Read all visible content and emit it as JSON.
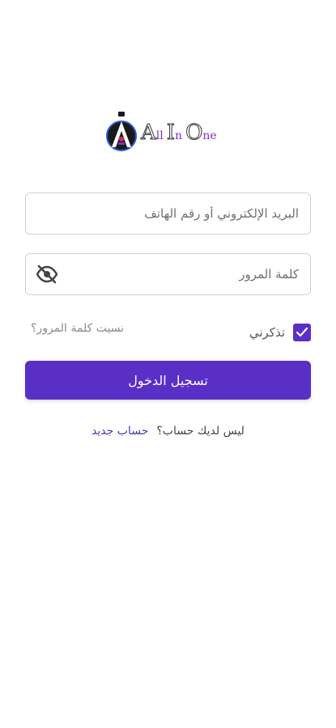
{
  "logo": {
    "letters_big": [
      "A",
      "I",
      "O"
    ],
    "letters_small": [
      "ll",
      "n",
      "ne"
    ],
    "accent_color": "#7b2fd6"
  },
  "login_form": {
    "email_placeholder": "البريد الإلكتروني أو رقم الهاتف",
    "email_value": "",
    "password_placeholder": "كلمة المرور",
    "password_value": "",
    "password_toggle_icon": "eye-off-icon",
    "remember_label": "تذكرني",
    "remember_checked": true,
    "forgot_password": "نسيت كلمة المرور؟",
    "login_label": "تسجيل الدخول",
    "primary_color": "#5a2fc7"
  },
  "signup": {
    "question": "ليس لديك حساب؟",
    "link": "حساب جديد"
  }
}
